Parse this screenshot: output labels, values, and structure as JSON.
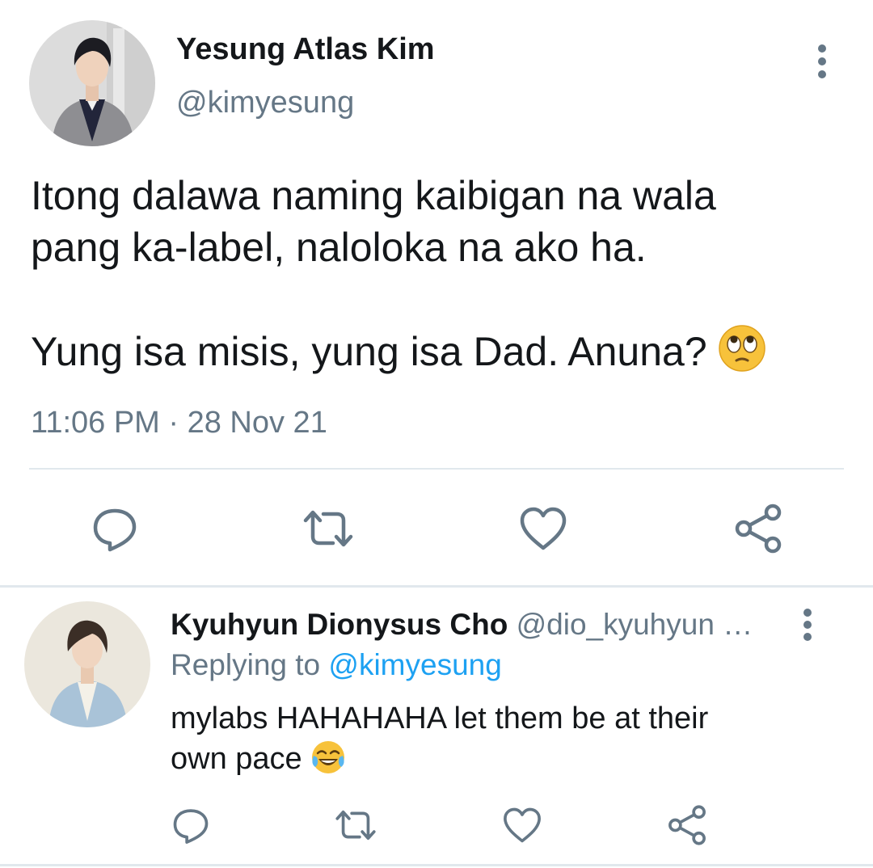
{
  "tweet": {
    "author_name": "Yesung Atlas Kim",
    "author_handle": "@kimyesung",
    "text_line1": "Itong dalawa naming kaibigan na wala",
    "text_line2": "pang ka-label, naloloka na ako ha.",
    "text_line3": "Yung isa misis, yung isa Dad. Anuna?",
    "text_emoji": "face-with-rolling-eyes",
    "timestamp": "11:06 PM · 28 Nov 21",
    "actions": [
      "reply-icon",
      "retweet-icon",
      "like-icon",
      "share-icon"
    ]
  },
  "reply": {
    "author_name": "Kyuhyun Dionysus Cho",
    "author_handle": "@dio_kyuhyun …",
    "replying_prefix": "Replying to ",
    "replying_to": "@kimyesung",
    "text_line1": "mylabs HAHAHAHA let them be at their",
    "text_line2": "own pace",
    "text_emoji": "face-with-tears-of-joy",
    "actions": [
      "reply-icon",
      "retweet-icon",
      "like-icon",
      "share-icon"
    ]
  },
  "colors": {
    "primary_text": "#14171a",
    "secondary_text": "#657786",
    "link": "#1da1f2",
    "icon": "#657786",
    "divider": "#e1e8ed"
  }
}
